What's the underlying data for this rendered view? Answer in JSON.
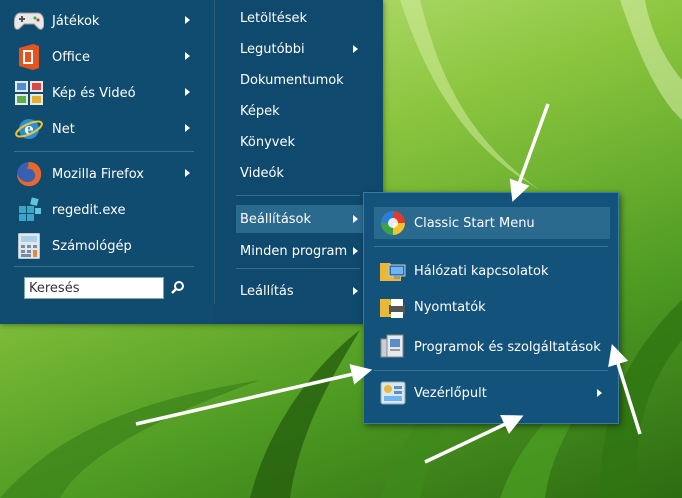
{
  "left_programs": [
    {
      "label": "Játékok",
      "icon": "gamepad-icon",
      "has_submenu": true
    },
    {
      "label": "Office",
      "icon": "office-icon",
      "has_submenu": true
    },
    {
      "label": "Kép és Videó",
      "icon": "photos-icon",
      "has_submenu": true
    },
    {
      "label": "Net",
      "icon": "internet-explorer-icon",
      "has_submenu": true
    },
    {
      "label": "Mozilla Firefox",
      "icon": "firefox-icon",
      "has_submenu": true
    },
    {
      "label": "regedit.exe",
      "icon": "regedit-icon",
      "has_submenu": false
    },
    {
      "label": "Számológép",
      "icon": "calculator-icon",
      "has_submenu": false
    }
  ],
  "search": {
    "placeholder": "Keresés"
  },
  "right_items": [
    {
      "label": "Letöltések",
      "has_submenu": false
    },
    {
      "label": "Legutóbbi",
      "has_submenu": true
    },
    {
      "label": "Dokumentumok",
      "has_submenu": false
    },
    {
      "label": "Képek",
      "has_submenu": false
    },
    {
      "label": "Könyvek",
      "has_submenu": false
    },
    {
      "label": "Videók",
      "has_submenu": false
    },
    {
      "label": "Beállítások",
      "has_submenu": true
    },
    {
      "label": "Minden program",
      "has_submenu": true
    },
    {
      "label": "Leállítás",
      "has_submenu": true
    }
  ],
  "submenu_items": [
    {
      "label": "Classic Start Menu",
      "icon": "classic-start-menu-icon",
      "has_submenu": false
    },
    {
      "label": "Hálózati kapcsolatok",
      "icon": "network-connections-icon",
      "has_submenu": false
    },
    {
      "label": "Nyomtatók",
      "icon": "printer-icon",
      "has_submenu": false
    },
    {
      "label": "Programok és szolgáltatások",
      "icon": "programs-features-icon",
      "has_submenu": false
    },
    {
      "label": "Vezérlőpult",
      "icon": "control-panel-icon",
      "has_submenu": true
    }
  ],
  "colors": {
    "menu_bg": "#104c70",
    "highlight": "#2a6a8f",
    "submenu_bg": "#13527a"
  }
}
